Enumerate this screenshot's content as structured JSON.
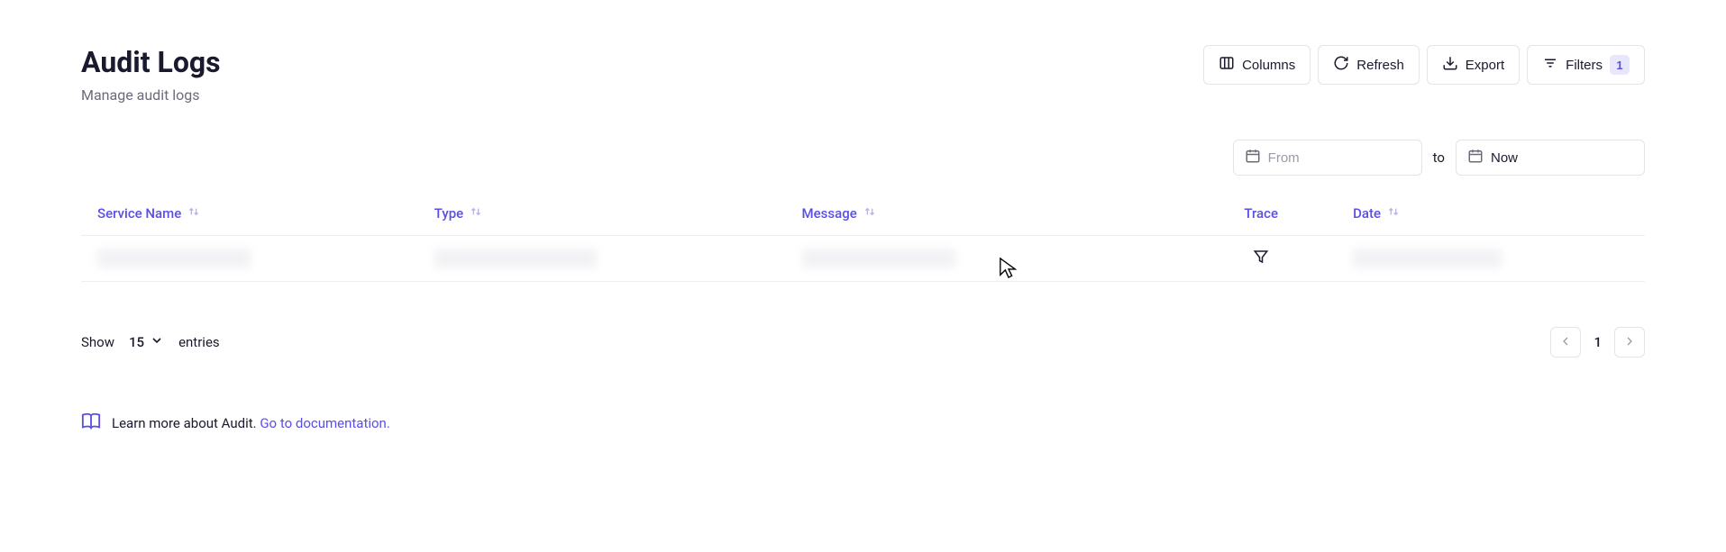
{
  "header": {
    "title": "Audit Logs",
    "subtitle": "Manage audit logs"
  },
  "toolbar": {
    "columns_label": "Columns",
    "refresh_label": "Refresh",
    "export_label": "Export",
    "filters_label": "Filters",
    "filters_count": "1"
  },
  "date_range": {
    "from_placeholder": "From",
    "from_value": "",
    "to_label": "to",
    "to_value": "Now"
  },
  "table": {
    "columns": {
      "service_name": "Service Name",
      "type": "Type",
      "message": "Message",
      "trace": "Trace",
      "date": "Date"
    }
  },
  "pagination": {
    "show_label": "Show",
    "page_size": "15",
    "entries_label": "entries",
    "current_page": "1"
  },
  "docs": {
    "text": "Learn more about Audit.",
    "link_text": "Go to documentation."
  }
}
